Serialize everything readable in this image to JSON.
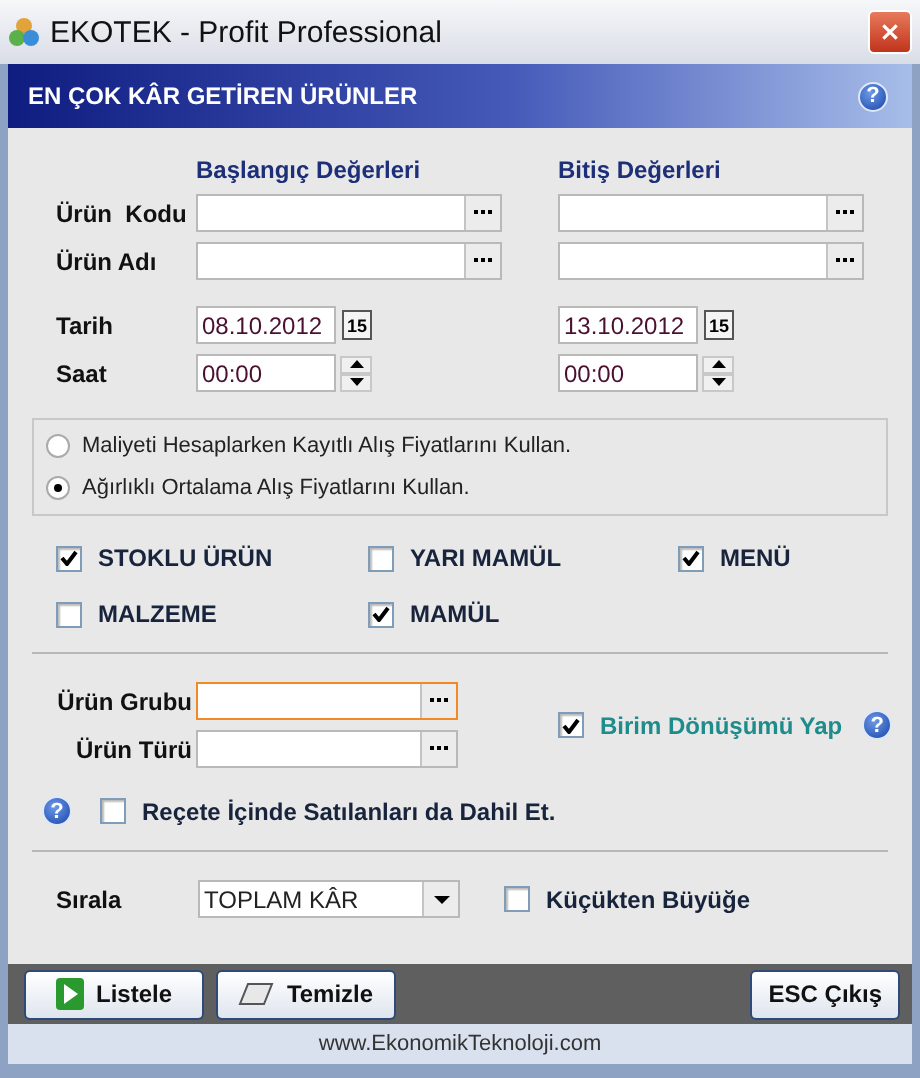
{
  "window": {
    "title": "EKOTEK - Profit Professional"
  },
  "header": {
    "title": "EN ÇOK KÂR GETİREN ÜRÜNLER",
    "help_label": "?"
  },
  "range": {
    "start_heading": "Başlangıç Değerleri",
    "end_heading": "Bitiş Değerleri",
    "rows": [
      {
        "label": "Ürün  Kodu",
        "kind": "lookup"
      },
      {
        "label": "Ürün Adı",
        "kind": "lookup"
      },
      {
        "label": "Tarih",
        "kind": "date",
        "start": "08.10.2012",
        "end": "13.10.2012",
        "start_picker_label": "15",
        "end_picker_label": "15"
      },
      {
        "label": "Saat",
        "kind": "time",
        "start": "00:00",
        "end": "00:00"
      }
    ]
  },
  "cost_method": [
    {
      "label": "Maliyeti Hesaplarken Kayıtlı Alış Fiyatlarını Kullan.",
      "selected": false
    },
    {
      "label": "Ağırlıklı Ortalama Alış Fiyatlarını Kullan.",
      "selected": true
    }
  ],
  "product_types": [
    {
      "label": "STOKLU ÜRÜN",
      "checked": true
    },
    {
      "label": "YARI MAMÜL",
      "checked": false
    },
    {
      "label": "MENÜ",
      "checked": true
    },
    {
      "label": "MALZEME",
      "checked": false
    },
    {
      "label": "MAMÜL",
      "checked": true
    }
  ],
  "groups": [
    {
      "label": "Ürün Grubu",
      "focused": true
    },
    {
      "label": "Ürün Türü",
      "focused": false
    }
  ],
  "unit_conversion": {
    "label": "Birim Dönüşümü Yap",
    "checked": true,
    "help_label": "?"
  },
  "recipe": {
    "label": "Reçete İçinde Satılanları da Dahil Et.",
    "checked": false,
    "help_label": "?"
  },
  "sort": {
    "label": "Sırala",
    "value": "TOPLAM KÂR",
    "ascending": {
      "label": "Küçükten Büyüğe",
      "checked": false
    }
  },
  "buttons": [
    {
      "label": "Listele",
      "kind": "list"
    },
    {
      "label": "Temizle",
      "kind": "clear"
    },
    {
      "label": "ESC Çıkış",
      "kind": "exit"
    }
  ],
  "footer": "www.EkonomikTeknoloji.com"
}
